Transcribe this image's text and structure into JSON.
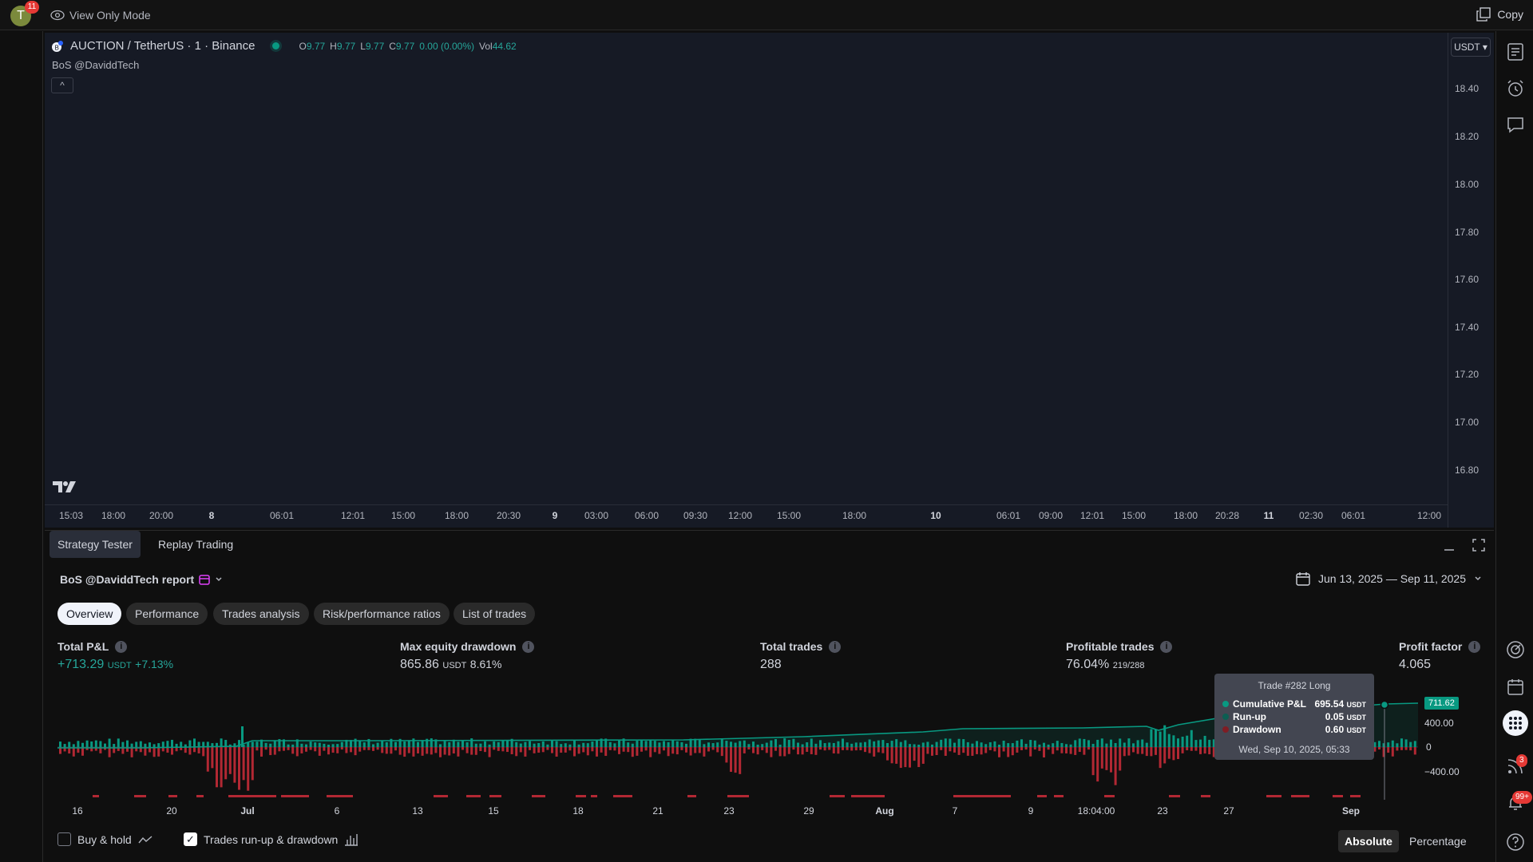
{
  "topbar": {
    "avatar_letter": "T",
    "avatar_badge": "11",
    "view_mode_label": "View Only Mode",
    "copy_label": "Copy"
  },
  "chart": {
    "symbol_legend": "AUCTION / TetherUS · 1 · Binance",
    "ohlc": {
      "o_label": "O",
      "o_value": "9.77",
      "h_label": "H",
      "h_value": "9.77",
      "l_label": "L",
      "l_value": "9.77",
      "c_label": "C",
      "c_value": "9.77",
      "change": "0.00 (0.00%)",
      "vol_label": "Vol",
      "vol_value": "44.62"
    },
    "indicator": "BoS @DaviddTech",
    "collapse_glyph": "^",
    "currency": "USDT",
    "price_labels": [
      "18.40",
      "18.20",
      "18.00",
      "17.80",
      "17.60",
      "17.40",
      "17.20",
      "17.00",
      "16.80"
    ],
    "time_labels": [
      "15:03",
      "18:00",
      "20:00",
      "8",
      "06:01",
      "12:01",
      "15:00",
      "18:00",
      "20:30",
      "9",
      "03:00",
      "06:00",
      "09:30",
      "12:00",
      "15:00",
      "18:00",
      "10",
      "06:01",
      "09:00",
      "12:01",
      "15:00",
      "18:00",
      "20:28",
      "11",
      "02:30",
      "06:01",
      "12:00"
    ]
  },
  "panel": {
    "tabs": [
      "Strategy Tester",
      "Replay Trading"
    ],
    "report_title": "BoS @DaviddTech report",
    "date_range": "Jun 13, 2025 — Sep 11, 2025",
    "subtabs": [
      "Overview",
      "Performance",
      "Trades analysis",
      "Risk/performance ratios",
      "List of trades"
    ],
    "metrics": {
      "total_pnl": {
        "label": "Total P&L",
        "value": "+713.29",
        "unit": "USDT",
        "pct": "+7.13%"
      },
      "max_dd": {
        "label": "Max equity drawdown",
        "value": "865.86",
        "unit": "USDT",
        "pct": "8.61%"
      },
      "total_trades": {
        "label": "Total trades",
        "value": "288"
      },
      "profitable": {
        "label": "Profitable trades",
        "value": "76.04%",
        "sub": "219/288"
      },
      "profit_factor": {
        "label": "Profit factor",
        "value": "4.065"
      }
    },
    "info_glyph": "i",
    "tooltip": {
      "title": "Trade #282 Long",
      "rows": [
        {
          "name": "Cumulative P&L",
          "value": "695.54",
          "unit": "USDT",
          "color": "#089981"
        },
        {
          "name": "Run-up",
          "value": "0.05",
          "unit": "USDT",
          "color": "#0c5e52"
        },
        {
          "name": "Drawdown",
          "value": "0.60",
          "unit": "USDT",
          "color": "#7f1d24"
        }
      ],
      "date": "Wed, Sep 10, 2025, 05:33"
    },
    "equity_current": "711.62",
    "equity_axis": [
      "400.00",
      "0",
      "−400.00"
    ],
    "equity_x_labels": [
      "16",
      "20",
      "Jul",
      "6",
      "13",
      "15",
      "18",
      "21",
      "23",
      "29",
      "Aug",
      "7",
      "9",
      "18:04:00",
      "23",
      "27",
      "Sep"
    ],
    "footer": {
      "buy_hold": "Buy & hold",
      "runup_dd": "Trades run-up & drawdown",
      "check_glyph": "✓",
      "absolute": "Absolute",
      "percentage": "Percentage"
    },
    "right_badges": {
      "feed": "3",
      "notifications": "99+"
    }
  },
  "colors": {
    "accent_green": "#089981",
    "loss_red": "#b22833",
    "text": "#d1d4dc"
  }
}
